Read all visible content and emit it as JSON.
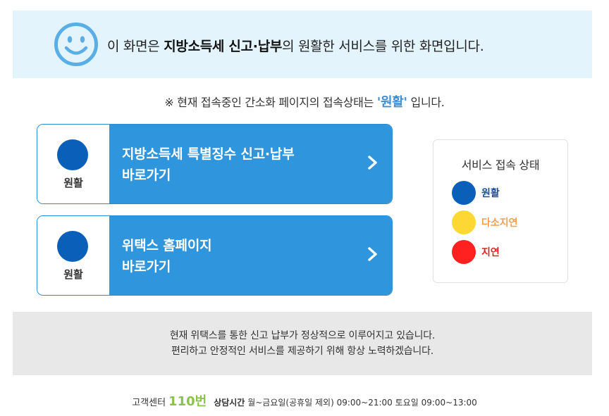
{
  "banner": {
    "prefix": "이 화면은 ",
    "bold": "지방소득세 신고·납부",
    "suffix": "의 원활한 서비스를 위한 화면입니다.",
    "icon": "smiley-face-icon",
    "icon_color": "#5aaee6"
  },
  "status_line": {
    "prefix": "※ 현재 접속중인 간소화 페이지의 접속상태는 ",
    "status": "'원활'",
    "suffix": " 입니다."
  },
  "cards": [
    {
      "status_label": "원활",
      "status_color": "#0a5fb8",
      "title_line1": "지방소득세 특별징수 신고·납부",
      "title_line2": "바로가기",
      "icon": "chevron-right-icon"
    },
    {
      "status_label": "원활",
      "status_color": "#0a5fb8",
      "title_line1": "위택스 홈페이지",
      "title_line2": "바로가기",
      "icon": "chevron-right-icon"
    }
  ],
  "legend": {
    "title": "서비스 접속 상태",
    "items": [
      {
        "label": "원활",
        "color": "#0a5fb8",
        "text_color": "#1a4f9c"
      },
      {
        "label": "다소지연",
        "color": "#fdd835",
        "text_color": "#f0a050"
      },
      {
        "label": "지연",
        "color": "#ff2020",
        "text_color": "#e02020"
      }
    ]
  },
  "notice": {
    "line1": "현재 위택스를 통한 신고 납부가 정상적으로 이루어지고 있습니다.",
    "line2": "편리하고 안정적인 서비스를 제공하기 위해 항상 노력하겠습니다."
  },
  "footer": {
    "center_label": "고객센터",
    "phone": "110번",
    "hours_label": "상담시간",
    "hours": "월~금요일(공휴일 제외) 09:00~21:00 토요일 09:00~13:00"
  }
}
